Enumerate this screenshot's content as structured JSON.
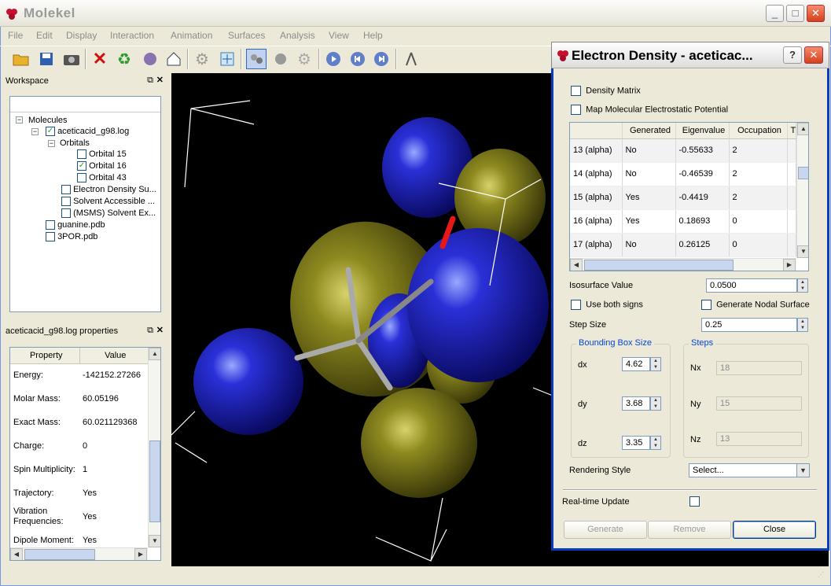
{
  "app": {
    "title": "Molekel"
  },
  "menu": [
    "File",
    "Edit",
    "Display",
    "Interaction",
    "Animation",
    "Surfaces",
    "Analysis",
    "View",
    "Help"
  ],
  "workspace": {
    "title": "Workspace",
    "root": "Molecules",
    "file": "aceticacid_g98.log",
    "orbitals_label": "Orbitals",
    "orbitals": [
      "Orbital 15",
      "Orbital 16",
      "Orbital 43"
    ],
    "surfaces": [
      "Electron Density Su...",
      "Solvent Accessible ...",
      "(MSMS) Solvent Ex..."
    ],
    "others": [
      "guanine.pdb",
      "3POR.pdb"
    ]
  },
  "properties": {
    "title": "aceticacid_g98.log properties",
    "col_property": "Property",
    "col_value": "Value",
    "rows": [
      {
        "k": "Energy:",
        "v": "-142152.27266"
      },
      {
        "k": "Molar Mass:",
        "v": "60.05196"
      },
      {
        "k": "Exact Mass:",
        "v": "60.021129368"
      },
      {
        "k": "Charge:",
        "v": "0"
      },
      {
        "k": "Spin Multiplicity:",
        "v": "1"
      },
      {
        "k": "Trajectory:",
        "v": "Yes"
      },
      {
        "k": "Vibration Frequencies:",
        "v": "Yes"
      },
      {
        "k": "Dipole Moment:",
        "v": "Yes"
      }
    ]
  },
  "dialog": {
    "title": "Electron Density - aceticac...",
    "density_matrix": "Density Matrix",
    "map_mep": "Map Molecular Electrostatic Potential",
    "columns": [
      "",
      "Generated",
      "Eigenvalue",
      "Occupation",
      "T"
    ],
    "rows": [
      [
        "13 (alpha)",
        "No",
        "-0.55633",
        "2"
      ],
      [
        "14 (alpha)",
        "No",
        "-0.46539",
        "2"
      ],
      [
        "15 (alpha)",
        "Yes",
        "-0.4419",
        "2"
      ],
      [
        "16 (alpha)",
        "Yes",
        "0.18693",
        "0"
      ],
      [
        "17 (alpha)",
        "No",
        "0.26125",
        "0"
      ]
    ],
    "iso_label": "Isosurface Value",
    "iso_value": "0.0500",
    "both_signs": "Use both signs",
    "nodal": "Generate Nodal Surface",
    "step_label": "Step Size",
    "step_value": "0.25",
    "bbox_title": "Bounding Box Size",
    "steps_title": "Steps",
    "dx_label": "dx",
    "dx": "4.62",
    "dy_label": "dy",
    "dy": "3.68",
    "dz_label": "dz",
    "dz": "3.35",
    "nx_label": "Nx",
    "nx": "18",
    "ny_label": "Ny",
    "ny": "15",
    "nz_label": "Nz",
    "nz": "13",
    "render_label": "Rendering Style",
    "render_value": "Select...",
    "realtime": "Real-time Update",
    "generate": "Generate",
    "remove": "Remove",
    "close": "Close"
  }
}
